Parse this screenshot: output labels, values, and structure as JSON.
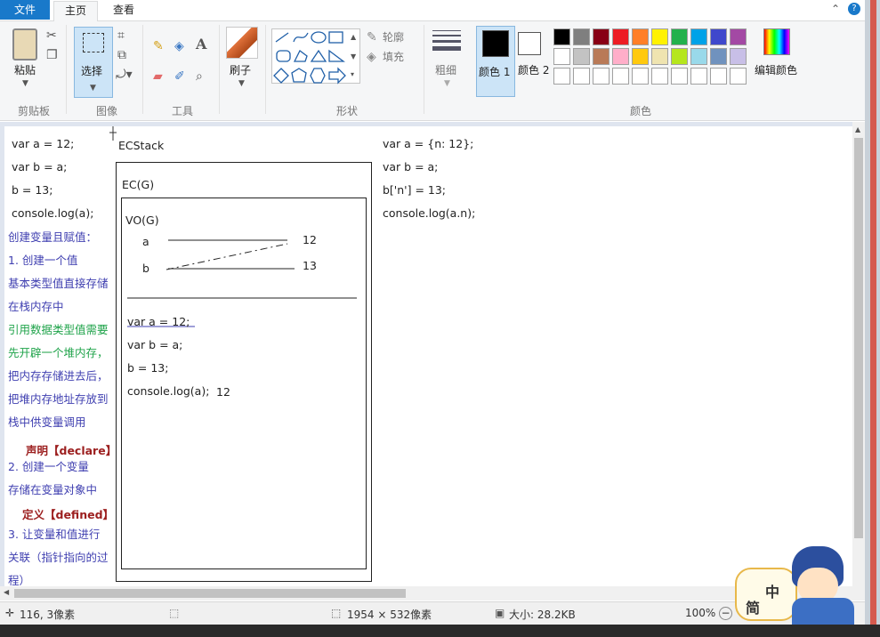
{
  "tabs": {
    "file": "文件",
    "home": "主页",
    "view": "查看"
  },
  "ribbon": {
    "paste": "粘贴",
    "clipboard": "剪贴板",
    "select": "选择",
    "image": "图像",
    "tools": "工具",
    "brush": "刷子",
    "shapes": "形状",
    "outline": "轮廓",
    "fill": "填充",
    "size": "粗细",
    "color1": "颜色 1",
    "color2": "颜色 2",
    "edit_colors": "编辑颜色",
    "colors": "颜色"
  },
  "palette": {
    "row1": [
      "#000000",
      "#7f7f7f",
      "#880015",
      "#ed1c24",
      "#ff7f27",
      "#fff200",
      "#22b14c",
      "#00a2e8",
      "#3f48cc",
      "#a349a4"
    ],
    "row2": [
      "#ffffff",
      "#c3c3c3",
      "#b97a57",
      "#ffaec9",
      "#ffc90e",
      "#efe4b0",
      "#b5e61d",
      "#99d9ea",
      "#7092be",
      "#c8bfe7"
    ],
    "row3": [
      "#ffffff",
      "#ffffff",
      "#ffffff",
      "#ffffff",
      "#ffffff",
      "#ffffff",
      "#ffffff",
      "#ffffff",
      "#ffffff",
      "#ffffff"
    ]
  },
  "canvas": {
    "left_code": [
      "var a = 12;",
      "var b = a;",
      "b = 13;",
      "console.log(a);"
    ],
    "notes": [
      "创建变量且赋值：",
      "1. 创建一个值",
      "基本类型值直接存储",
      "在栈内存中",
      "引用数据类型值需要",
      "先开辟一个堆内存，",
      "把内存存储进去后，",
      "把堆内存地址存放到",
      "栈中供变量调用"
    ],
    "declare_title": "声明【declare】",
    "declare_items": [
      "2. 创建一个变量",
      "存储在变量对象中"
    ],
    "defined_title": "定义【defined】",
    "defined_items": [
      "3. 让变量和值进行",
      "关联（指针指向的过",
      "程）"
    ],
    "ecstack": "ECStack",
    "ecg": "EC(G)",
    "vog": "VO(G)",
    "var_a": "a",
    "var_b": "b",
    "val_12": "12",
    "val_13": "13",
    "inner_code": [
      "var a = 12;",
      "var b = a;",
      "b = 13;",
      "console.log(a);"
    ],
    "inner_output": "12",
    "right_code": [
      "var a = {n: 12};",
      "var b = a;",
      "b['n'] = 13;",
      "console.log(a.n);"
    ]
  },
  "status": {
    "cursor": "116, 3像素",
    "dimensions": "1954 × 532像素",
    "size": "大小: 28.2KB",
    "zoom": "100%"
  },
  "mascot": {
    "text1": "中",
    "text2": "简"
  }
}
